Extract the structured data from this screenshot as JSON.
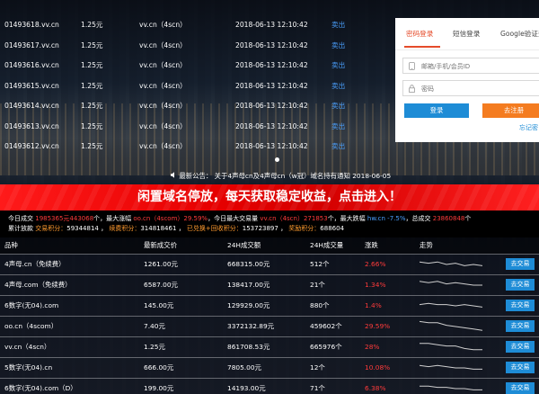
{
  "scroll_rows": [
    {
      "domain": "01493618.vv.cn",
      "price": "1.25元",
      "type": "vv.cn（4scn）",
      "date": "2018-06-13 12:10:42",
      "status": "卖出"
    },
    {
      "domain": "01493617.vv.cn",
      "price": "1.25元",
      "type": "vv.cn（4scn）",
      "date": "2018-06-13 12:10:42",
      "status": "卖出"
    },
    {
      "domain": "01493616.vv.cn",
      "price": "1.25元",
      "type": "vv.cn（4scn）",
      "date": "2018-06-13 12:10:42",
      "status": "卖出"
    },
    {
      "domain": "01493615.vv.cn",
      "price": "1.25元",
      "type": "vv.cn（4scn）",
      "date": "2018-06-13 12:10:42",
      "status": "卖出"
    },
    {
      "domain": "01493614.vv.cn",
      "price": "1.25元",
      "type": "vv.cn（4scn）",
      "date": "2018-06-13 12:10:42",
      "status": "卖出"
    },
    {
      "domain": "01493613.vv.cn",
      "price": "1.25元",
      "type": "vv.cn（4scn）",
      "date": "2018-06-13 12:10:42",
      "status": "卖出"
    },
    {
      "domain": "01493612.vv.cn",
      "price": "1.25元",
      "type": "vv.cn（4scn）",
      "date": "2018-06-13 12:10:42",
      "status": "卖出"
    }
  ],
  "notice": "最新公告：  关于4声母cn及4声母cn（w冠）域名持有通知  2018-06-05",
  "login": {
    "tabs": [
      "密码登录",
      "短信登录",
      "Google验证登"
    ],
    "account_placeholder": "邮箱/手机/会员ID",
    "password_placeholder": "密码",
    "login_label": "登录",
    "register_label": "去注册",
    "forgot_label": "忘记密"
  },
  "banner": "闲置域名停放，每天获取稳定收益，点击进入！",
  "stats": {
    "line1": {
      "t1": "今日成交 ",
      "v1": "1985365元",
      "v2": "443068",
      "t2": "个，最大涨幅 ",
      "v3": "oo.cn（4scom）29.59%",
      "t3": "，今日最大交易量 ",
      "v4": "vv.cn（4scn）271853",
      "t4": "个，最大跌幅 ",
      "v5": "hw.cn -7.5%",
      "t5": "，总成交 ",
      "v6": "23860848",
      "t6": "个"
    },
    "line2": {
      "t1": "累计放款  ",
      "l1": "交易积分：",
      "v1": "59344814",
      "s1": "  ，  ",
      "l2": "续费积分：",
      "v2": "314818461",
      "s2": "  ，  ",
      "l3": "已兑换+回收积分：",
      "v3": "153723897",
      "s3": "  ，  ",
      "l4": "奖励积分：",
      "v4": "688604"
    }
  },
  "table": {
    "headers": [
      "品种",
      "最新成交价",
      "24H成交额",
      "24H成交量",
      "涨跌",
      "走势"
    ],
    "go_label": "去交易",
    "rows": [
      {
        "name": "4声母.cn（免续费）",
        "price": "1261.00元",
        "volume": "668315.00元",
        "count": "512个",
        "change": "2.66%",
        "trend": [
          7,
          6,
          7,
          5,
          6,
          4,
          5,
          4
        ]
      },
      {
        "name": "4声母.com（免续费）",
        "price": "6587.00元",
        "volume": "138417.00元",
        "count": "21个",
        "change": "1.34%",
        "trend": [
          8,
          7,
          8,
          6,
          7,
          6,
          5,
          5
        ]
      },
      {
        "name": "6数字(无04).com",
        "price": "145.00元",
        "volume": "129929.00元",
        "count": "880个",
        "change": "1.4%",
        "trend": [
          6,
          7,
          6,
          6,
          5,
          6,
          5,
          4
        ]
      },
      {
        "name": "oo.cn（4scom）",
        "price": "7.40元",
        "volume": "3372132.89元",
        "count": "459602个",
        "change": "29.59%",
        "trend": [
          9,
          8,
          8,
          6,
          5,
          4,
          3,
          2
        ]
      },
      {
        "name": "vv.cn（4scn）",
        "price": "1.25元",
        "volume": "861708.53元",
        "count": "665976个",
        "change": "28%",
        "trend": [
          8,
          8,
          7,
          6,
          6,
          4,
          3,
          3
        ]
      },
      {
        "name": "5数字(无04).cn",
        "price": "666.00元",
        "volume": "7805.00元",
        "count": "12个",
        "change": "10.08%",
        "trend": [
          7,
          6,
          7,
          6,
          5,
          5,
          4,
          4
        ]
      },
      {
        "name": "6数字(无04).com（D）",
        "price": "199.00元",
        "volume": "14193.00元",
        "count": "71个",
        "change": "6.38%",
        "trend": [
          7,
          7,
          6,
          6,
          5,
          5,
          4,
          4
        ]
      }
    ]
  },
  "colors": {
    "accent_blue": "#1e8cd6",
    "accent_orange": "#f47c20",
    "rise_red": "#ff3b3b",
    "banner_red": "#e60000"
  }
}
